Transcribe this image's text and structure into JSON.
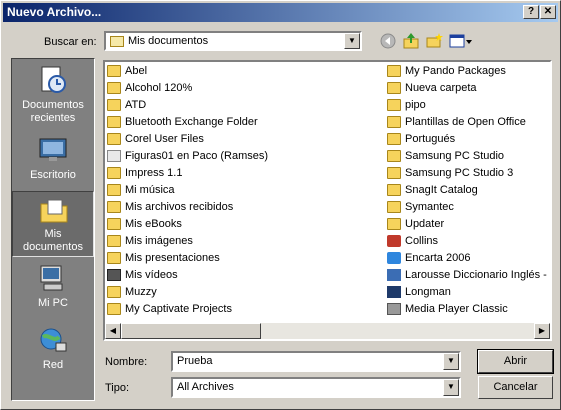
{
  "window": {
    "title": "Nuevo Archivo...",
    "help": "?",
    "close": "✕"
  },
  "lookin": {
    "label": "Buscar en:",
    "value": "Mis documentos"
  },
  "toolbar": {
    "back": "back-icon",
    "up": "up-folder-icon",
    "newfolder": "new-folder-icon",
    "views": "views-icon"
  },
  "places": [
    {
      "label": "Documentos recientes",
      "icon": "recent-documents-icon"
    },
    {
      "label": "Escritorio",
      "icon": "desktop-icon"
    },
    {
      "label": "Mis documentos",
      "icon": "my-documents-icon"
    },
    {
      "label": "Mi PC",
      "icon": "my-computer-icon"
    },
    {
      "label": "Red",
      "icon": "network-icon"
    }
  ],
  "files_col1": [
    {
      "name": "Abel",
      "icon": "folder"
    },
    {
      "name": "Alcohol 120%",
      "icon": "folder"
    },
    {
      "name": "ATD",
      "icon": "folder"
    },
    {
      "name": "Bluetooth Exchange Folder",
      "icon": "folder"
    },
    {
      "name": "Corel User Files",
      "icon": "folder"
    },
    {
      "name": "Figuras01 en Paco (Ramses)",
      "icon": "shortcut"
    },
    {
      "name": "Impress 1.1",
      "icon": "folder"
    },
    {
      "name": "Mi música",
      "icon": "music"
    },
    {
      "name": "Mis archivos recibidos",
      "icon": "folder"
    },
    {
      "name": "Mis eBooks",
      "icon": "folder"
    },
    {
      "name": "Mis imágenes",
      "icon": "pictures"
    },
    {
      "name": "Mis presentaciones",
      "icon": "folder"
    },
    {
      "name": "Mis vídeos",
      "icon": "video"
    },
    {
      "name": "Muzzy",
      "icon": "folder"
    },
    {
      "name": "My Captivate Projects",
      "icon": "folder"
    }
  ],
  "files_col2": [
    {
      "name": "My Pando Packages",
      "icon": "folder"
    },
    {
      "name": "Nueva carpeta",
      "icon": "folder"
    },
    {
      "name": "pipo",
      "icon": "folder"
    },
    {
      "name": "Plantillas de Open Office",
      "icon": "folder"
    },
    {
      "name": "Portugués",
      "icon": "folder"
    },
    {
      "name": "Samsung PC Studio",
      "icon": "folder"
    },
    {
      "name": "Samsung PC Studio 3",
      "icon": "folder"
    },
    {
      "name": "SnagIt Catalog",
      "icon": "folder"
    },
    {
      "name": "Symantec",
      "icon": "folder"
    },
    {
      "name": "Updater",
      "icon": "folder"
    },
    {
      "name": "Collins",
      "icon": "app-red"
    },
    {
      "name": "Encarta 2006",
      "icon": "app-blue"
    },
    {
      "name": "Larousse Diccionario Inglés - E",
      "icon": "app-n"
    },
    {
      "name": "Longman",
      "icon": "app-dark"
    },
    {
      "name": "Media Player Classic",
      "icon": "app-gray"
    }
  ],
  "filename": {
    "label": "Nombre:",
    "value": "Prueba"
  },
  "filetype": {
    "label": "Tipo:",
    "value": "All Archives"
  },
  "buttons": {
    "open": "Abrir",
    "cancel": "Cancelar"
  },
  "scroll": {
    "left": "◀",
    "right": "▶",
    "dropdown": "▼"
  },
  "colors": {
    "titlebar_start": "#0a246a",
    "titlebar_end": "#a6caf0",
    "face": "#d4d0c8",
    "places_bg": "#808080"
  }
}
